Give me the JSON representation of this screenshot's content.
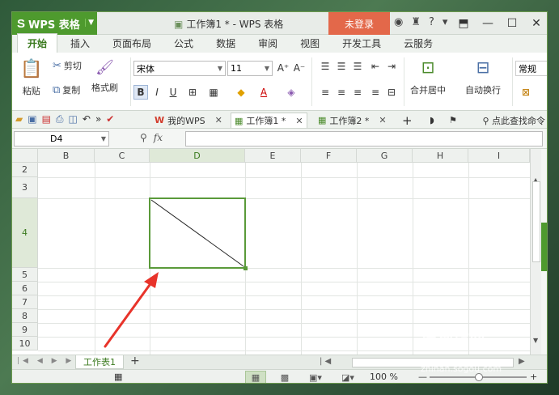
{
  "title_bar": {
    "app_logo": "S",
    "app_name": "WPS 表格",
    "doc_title": "工作簿1 * - WPS 表格",
    "login_label": "未登录",
    "help_label": "?"
  },
  "ribbon_tabs": [
    "开始",
    "插入",
    "页面布局",
    "公式",
    "数据",
    "审阅",
    "视图",
    "开发工具",
    "云服务"
  ],
  "ribbon": {
    "paste": "粘贴",
    "cut": "剪切",
    "copy": "复制",
    "format_painter": "格式刷",
    "font_name": "宋体",
    "font_size": "11",
    "grow_font": "A⁺",
    "shrink_font": "A⁻",
    "bold": "B",
    "italic": "I",
    "underline": "U",
    "merge_center": "合并居中",
    "wrap_text": "自动换行",
    "number_format": "常规"
  },
  "doc_tabs": {
    "my_wps": "我的WPS",
    "book1": "工作簿1 *",
    "book2": "工作簿2 *",
    "find": "点此查找命令"
  },
  "formula_bar": {
    "name_box": "D4",
    "fx": "fx"
  },
  "grid": {
    "columns": [
      "B",
      "C",
      "D",
      "E",
      "F",
      "G",
      "H",
      "I"
    ],
    "rows": [
      "2",
      "3",
      "4",
      "5",
      "6",
      "7",
      "8",
      "9",
      "10"
    ],
    "active_col": "D",
    "active_row": "4"
  },
  "sheet_tabs": {
    "active": "工作表1",
    "add": "+"
  },
  "status_bar": {
    "zoom": "100 %"
  },
  "watermark": {
    "text": "搜狗指南",
    "url": "zhinan.sogou.com"
  },
  "colors": {
    "accent": "#4e9a2e",
    "login": "#e3684a",
    "arrow": "#e8332a"
  }
}
